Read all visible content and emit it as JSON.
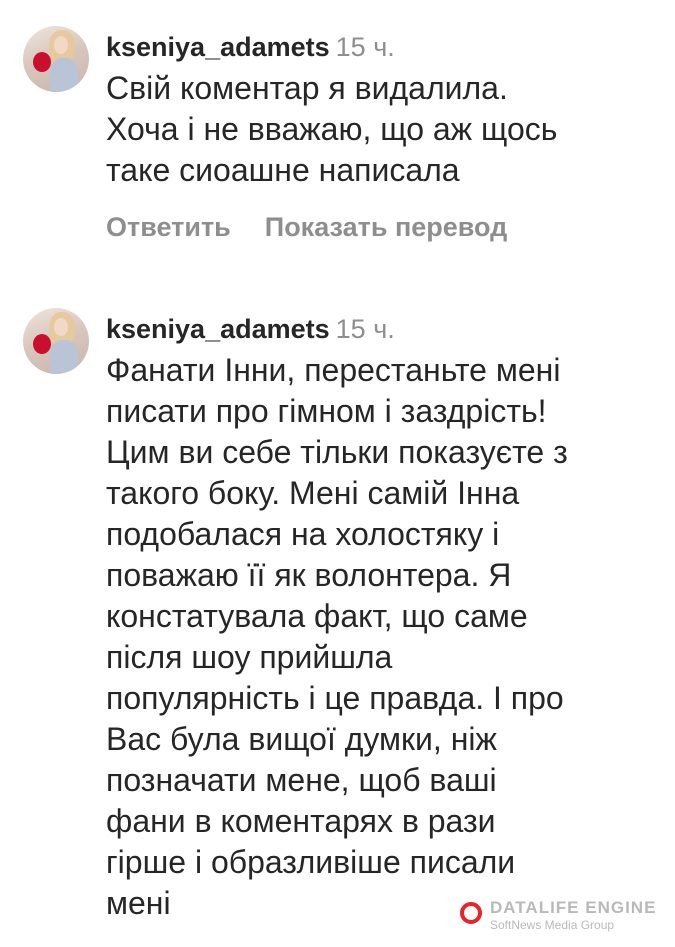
{
  "comments": [
    {
      "username": "kseniya_adamets",
      "timestamp": "15 ч.",
      "text_lines": [
        "Свій коментар я видалила.",
        "Хоча і не вважаю, що аж щось",
        "таке сиоашне написала"
      ],
      "actions": {
        "reply": "Ответить",
        "translate": "Показать перевод"
      }
    },
    {
      "username": "kseniya_adamets",
      "timestamp": "15 ч.",
      "text_lines": [
        "Фанати Інни, перестаньте мені",
        "писати про гімном і заздрість!",
        "Цим ви себе тільки показуєте з",
        "такого боку. Мені самій Інна",
        "подобалася на холостяку і",
        "поважаю її як волонтера. Я",
        "констатувала факт, що саме",
        "після шоу прийшла",
        "популярність і це правда. І про",
        "Вас була вищої думки, ніж",
        "позначати мене, щоб ваші",
        "фани в коментарях в рази",
        "гірше і образливіше писали",
        "мені"
      ]
    }
  ],
  "watermark": {
    "title": "DATALIFE ENGINE",
    "subtitle": "SoftNews Media Group",
    "icon": "datalife-logo-icon",
    "accent_color": "#e8232a"
  },
  "colors": {
    "text": "#262626",
    "secondary": "#8e8e8e",
    "background": "#ffffff"
  }
}
